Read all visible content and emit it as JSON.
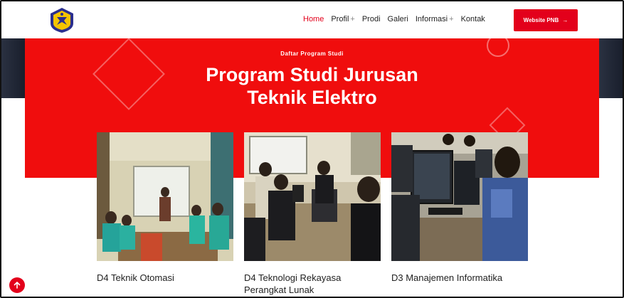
{
  "header": {
    "logo_name": "university-logo",
    "nav": [
      {
        "label": "Home",
        "active": true,
        "has_plus": false
      },
      {
        "label": "Profil",
        "active": false,
        "has_plus": true
      },
      {
        "label": "Prodi",
        "active": false,
        "has_plus": false
      },
      {
        "label": "Galeri",
        "active": false,
        "has_plus": false
      },
      {
        "label": "Informasi",
        "active": false,
        "has_plus": true
      },
      {
        "label": "Kontak",
        "active": false,
        "has_plus": false
      }
    ],
    "plus_symbol": "+",
    "cta_label": "Website PNB",
    "cta_arrow": "→"
  },
  "hero": {
    "subtitle": "Daftar Program Studi",
    "title_line1": "Program Studi Jurusan",
    "title_line2": "Teknik Elektro"
  },
  "cards": [
    {
      "title": "D4 Teknik Otomasi"
    },
    {
      "title_line1": "D4 Teknologi Rekayasa",
      "title_line2": "Perangkat Lunak"
    },
    {
      "title": "D3 Manajemen Informatika"
    }
  ],
  "colors": {
    "brand_red": "#e3001b",
    "hero_red": "#f00d0d",
    "dark_strip": "#1f2637"
  }
}
